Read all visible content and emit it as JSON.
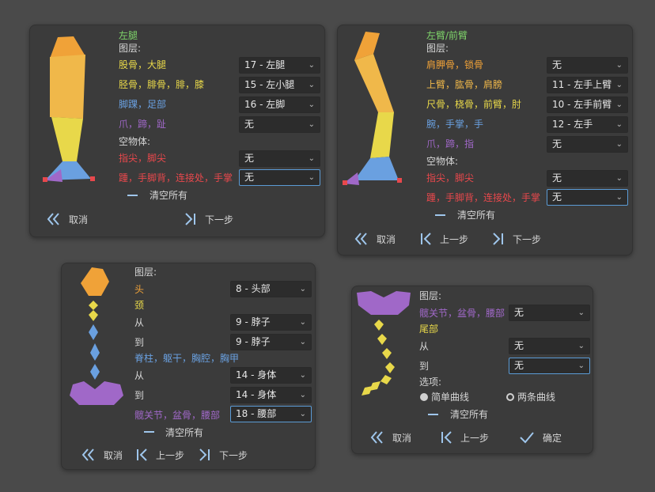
{
  "colors": {
    "green": "#7ed36a",
    "yellow": "#e8d84a",
    "orange": "#f0a238",
    "blue": "#6aa0e0",
    "purple": "#a068c8",
    "red": "#e8484c",
    "white": "#d6d6d6"
  },
  "p1": {
    "title": "左腿",
    "layers": "图层:",
    "rows": [
      {
        "label": "股骨，大腿",
        "value": "17 - 左腿"
      },
      {
        "label": "胫骨，腓骨，腓，膝",
        "value": "15 - 左小腿"
      },
      {
        "label": "脚踝，足部",
        "value": "16 - 左脚"
      },
      {
        "label": "爪，蹄，趾",
        "value": "无"
      }
    ],
    "empty": "空物体:",
    "erows": [
      {
        "label": "指尖，脚尖",
        "value": "无"
      },
      {
        "label": "踵，手脚背，连接处，手掌",
        "value": "无"
      }
    ],
    "clear": "清空所有",
    "cancel": "取消",
    "next": "下一步"
  },
  "p2": {
    "title": "左臂/前臂",
    "layers": "图层:",
    "rows": [
      {
        "label": "肩胛骨，锁骨",
        "value": "无"
      },
      {
        "label": "上臂，肱骨，肩膀",
        "value": "11 - 左手上臂"
      },
      {
        "label": "尺骨，桡骨，前臂，肘",
        "value": "10 - 左手前臂"
      },
      {
        "label": "腕，手掌，手",
        "value": "12 - 左手"
      },
      {
        "label": "爪，蹄，指",
        "value": "无"
      }
    ],
    "empty": "空物体:",
    "erows": [
      {
        "label": "指尖，脚尖",
        "value": "无"
      },
      {
        "label": "踵，手脚背，连接处，手掌",
        "value": "无"
      }
    ],
    "clear": "清空所有",
    "cancel": "取消",
    "prev": "上一步",
    "next": "下一步"
  },
  "p3": {
    "layers": "图层:",
    "head": {
      "label": "头",
      "value": "8 - 头部"
    },
    "neck": "颈",
    "neck_from": {
      "label": "从",
      "value": "9 - 脖子"
    },
    "neck_to": {
      "label": "到",
      "value": "9 - 脖子"
    },
    "spine": "脊柱，躯干，胸腔，胸甲",
    "spine_from": {
      "label": "从",
      "value": "14 - 身体"
    },
    "spine_to": {
      "label": "到",
      "value": "14 - 身体"
    },
    "hip": {
      "label": "髋关节，盆骨，腰部",
      "value": "18 - 腰部"
    },
    "clear": "清空所有",
    "cancel": "取消",
    "prev": "上一步",
    "next": "下一步"
  },
  "p4": {
    "layers": "图层:",
    "hip": {
      "label": "髋关节，盆骨，腰部",
      "value": "无"
    },
    "tail": "尾部",
    "tail_from": {
      "label": "从",
      "value": "无"
    },
    "tail_to": {
      "label": "到",
      "value": "无"
    },
    "options": "选项:",
    "opt1": "简单曲线",
    "opt2": "两条曲线",
    "clear": "清空所有",
    "cancel": "取消",
    "prev": "上一步",
    "confirm": "确定"
  }
}
